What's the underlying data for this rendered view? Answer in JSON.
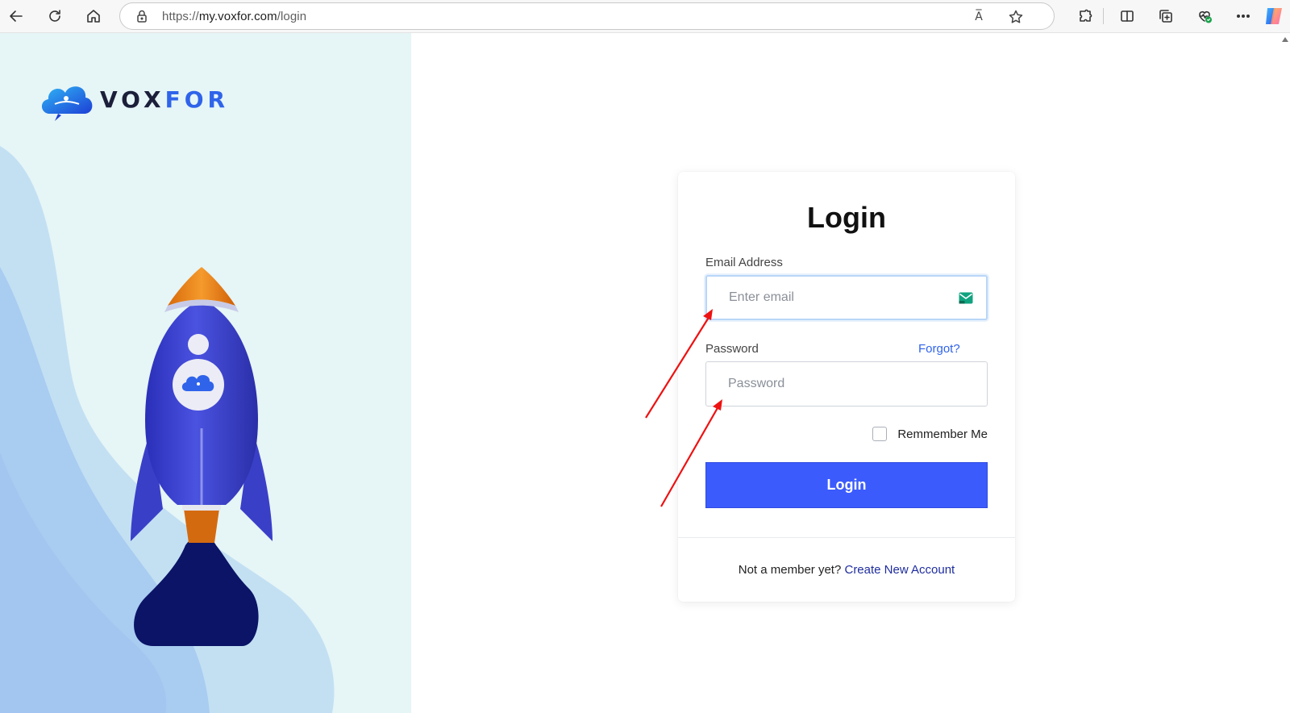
{
  "browser": {
    "url_scheme": "https://",
    "url_host": "my.voxfor.com",
    "url_path": "/login",
    "read_aloud_label": "A̅"
  },
  "brand": {
    "name_part1": "VOX",
    "name_part2": "FOR"
  },
  "login_form": {
    "title": "Login",
    "email_label": "Email Address",
    "email_placeholder": "Enter email",
    "password_label": "Password",
    "forgot_label": "Forgot?",
    "password_placeholder": "Password",
    "remember_label": "Remmember Me",
    "submit_label": "Login",
    "signup_prompt": "Not a member yet?",
    "signup_link": "Create New Account"
  },
  "colors": {
    "primary": "#3b5bfd",
    "link": "#2f63ea",
    "panel_bg": "#e6f5f6",
    "annotation_arrow": "#ee1111"
  }
}
